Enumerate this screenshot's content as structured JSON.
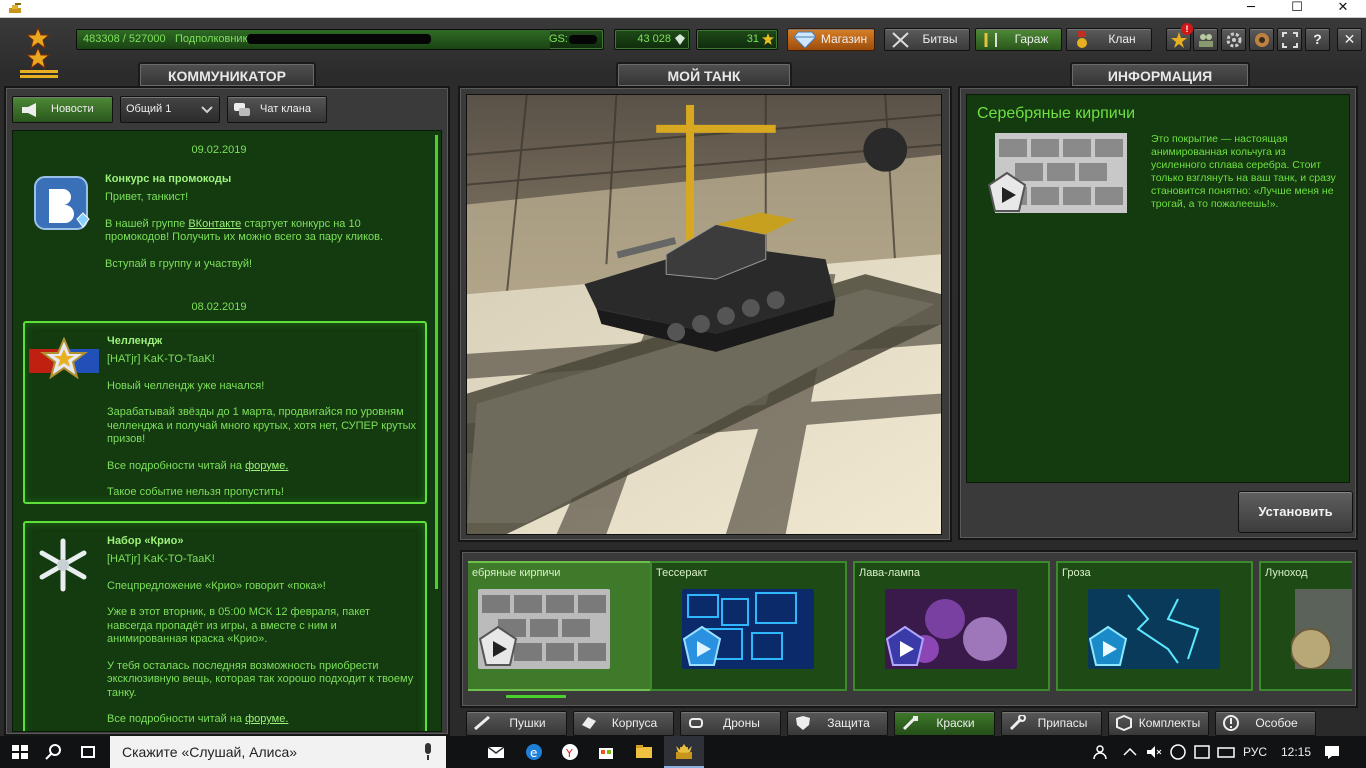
{
  "window": {
    "minimize": "─",
    "maximize": "☐",
    "close": "✕"
  },
  "topbar": {
    "xp": "483308 / 527000",
    "rank_name": "Подполковник",
    "gs_label": "GS:",
    "crystals": "43 028",
    "stars": "31",
    "shop_label": "Магазин",
    "battles_label": "Битвы",
    "garage_label": "Гараж",
    "clan_label": "Клан",
    "help_label": "?",
    "close_label": "✕"
  },
  "communicator": {
    "tab": "КОММУНИКАТОР",
    "news_button": "Новости",
    "channel_select": "Общий 1",
    "clan_chat_button": "Чат клана",
    "news": [
      {
        "date": "09.02.2019",
        "title": "Конкурс на промокоды",
        "greeting": "Привет, танкист!",
        "line1_pre": "В нашей группе ",
        "link": "ВКонтакте",
        "line1_post": " стартует конкурс на 10 промокодов! Получить их можно всего за пару кликов.",
        "line2": "Вступай в группу и участвуй!"
      },
      {
        "date": "08.02.2019",
        "title": "Челлендж",
        "author": "[HATjr] KaK-TO-TaaK!",
        "line1": "Новый челлендж уже начался!",
        "line2": "Зарабатывай звёзды до 1 марта, продвигайся по уровням челленджа и получай много крутых, хотя нет, СУПЕР крутых призов!",
        "line3_pre": "Все подробности читай на ",
        "link": "форуме.",
        "line4": "Такое событие нельзя пропустить!"
      },
      {
        "title": "Набор «Крио»",
        "author": "[HATjr] KaK-TO-TaaK!",
        "line1": "Спецпредложение «Крио» говорит «пока»!",
        "line2": "Уже в этот вторник, в 05:00 МСК 12 февраля, пакет навсегда пропадёт из игры, а вместе с ним и анимированная краска «Крио».",
        "line3": "У тебя осталась последняя возможность приобрести эксклюзивную вещь, которая так хорошо подходит к твоему танку.",
        "line4_pre": "Все подробности читай на ",
        "link": "форуме."
      }
    ]
  },
  "my_tank": {
    "tab": "МОЙ ТАНК"
  },
  "info": {
    "tab": "ИНФОРМАЦИЯ",
    "title": "Серебряные кирпичи",
    "description": "Это покрытие — настоящая анимированная кольчуга из усиленного сплава серебра. Стоит только взглянуть на ваш танк, и сразу становится понятно: «Лучше меня не трогай, а то пожалеешь!».",
    "install_button": "Установить"
  },
  "items": [
    {
      "name": "ебряные кирпичи",
      "selected": true
    },
    {
      "name": "Тессеракт"
    },
    {
      "name": "Лава-лампа"
    },
    {
      "name": "Гроза"
    },
    {
      "name": "Луноход"
    }
  ],
  "categories": [
    "Пушки",
    "Корпуса",
    "Дроны",
    "Защита",
    "Краски",
    "Припасы",
    "Комплекты",
    "Особое"
  ],
  "active_category": "Краски",
  "taskbar": {
    "search_placeholder": "Скажите «Слушай, Алиса»",
    "lang": "РУС",
    "time": "12:15"
  },
  "colors": {
    "accent_green": "#7ce05a",
    "panel_green": "#143a10",
    "shop_orange": "#c46a14"
  }
}
